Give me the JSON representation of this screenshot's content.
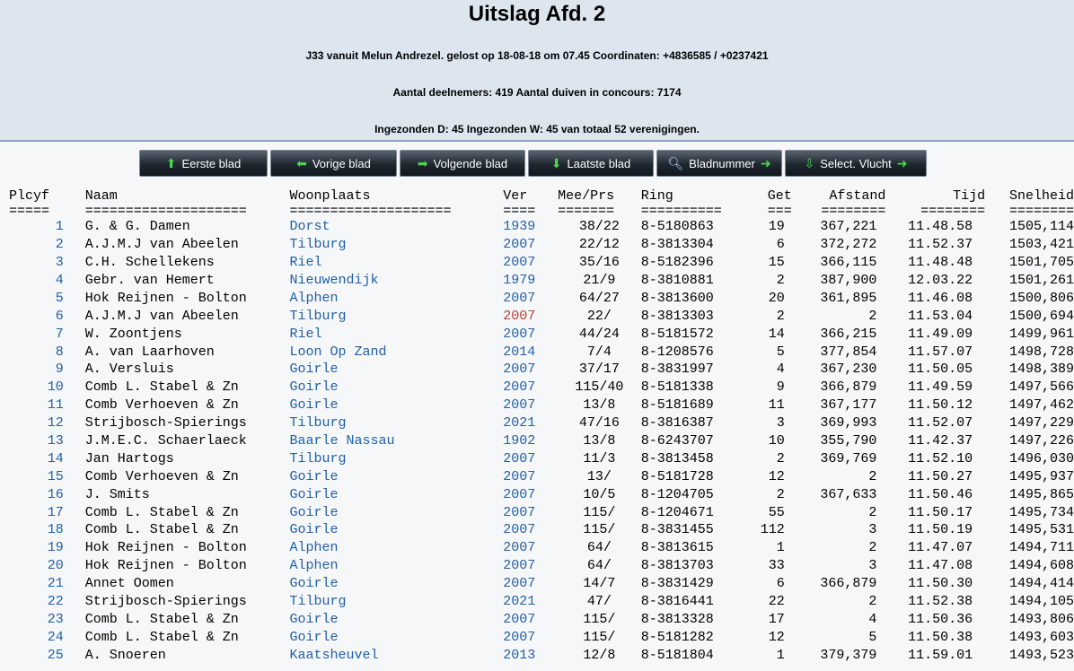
{
  "header": {
    "title": "Uitslag Afd. 2",
    "line1": "J33 vanuit Melun Andrezel. gelost op 18-08-18 om 07.45 Coordinaten: +4836585 / +0237421",
    "line2": "Aantal deelnemers: 419 Aantal duiven in concours: 7174",
    "line3": "Ingezonden D: 45 Ingezonden W: 45 van totaal 52 verenigingen."
  },
  "toolbar": {
    "first": {
      "label": "Eerste blad",
      "icon": "arrow-up-icon"
    },
    "prev": {
      "label": "Vorige blad",
      "icon": "arrow-left-icon"
    },
    "next": {
      "label": "Volgende blad",
      "icon": "arrow-right-icon"
    },
    "last": {
      "label": "Laatste blad",
      "icon": "arrow-down-icon"
    },
    "page": {
      "label": "Bladnummer",
      "icon": "magnifier-icon"
    },
    "select": {
      "label": "Select. Vlucht",
      "icon": "download-icon"
    }
  },
  "table": {
    "headers": [
      "Plcyf",
      "Naam",
      "Woonplaats",
      "Ver",
      "Mee/Prs",
      "Ring",
      "Get",
      "Afstand",
      "Tijd",
      "Snelheid"
    ],
    "separators": [
      "=====",
      "====================",
      "====================",
      "====",
      "=======",
      "==========",
      "===",
      "========",
      "========",
      "========"
    ],
    "rows": [
      [
        "1",
        "G. & G. Damen",
        "Dorst",
        "1939",
        "38/22",
        "8-5180863",
        "19",
        "367,221",
        "11.48.58",
        "1505,114"
      ],
      [
        "2",
        "A.J.M.J van Abeelen",
        "Tilburg",
        "2007",
        "22/12",
        "8-3813304",
        "6",
        "372,272",
        "11.52.37",
        "1503,421"
      ],
      [
        "3",
        "C.H. Schellekens",
        "Riel",
        "2007",
        "35/16",
        "8-5182396",
        "15",
        "366,115",
        "11.48.48",
        "1501,705"
      ],
      [
        "4",
        "Gebr. van Hemert",
        "Nieuwendijk",
        "1979",
        "21/9",
        "8-3810881",
        "2",
        "387,900",
        "12.03.22",
        "1501,261"
      ],
      [
        "5",
        "Hok Reijnen - Bolton",
        "Alphen",
        "2007",
        "64/27",
        "8-3813600",
        "20",
        "361,895",
        "11.46.08",
        "1500,806"
      ],
      [
        "6",
        "A.J.M.J van Abeelen",
        "Tilburg",
        "2007",
        "22/",
        "8-3813303",
        "2",
        "2",
        "11.53.04",
        "1500,694"
      ],
      [
        "7",
        "W. Zoontjens",
        "Riel",
        "2007",
        "44/24",
        "8-5181572",
        "14",
        "366,215",
        "11.49.09",
        "1499,961"
      ],
      [
        "8",
        "A. van Laarhoven",
        "Loon Op Zand",
        "2014",
        "7/4",
        "8-1208576",
        "5",
        "377,854",
        "11.57.07",
        "1498,728"
      ],
      [
        "9",
        "A. Versluis",
        "Goirle",
        "2007",
        "37/17",
        "8-3831997",
        "4",
        "367,230",
        "11.50.05",
        "1498,389"
      ],
      [
        "10",
        "Comb L. Stabel & Zn",
        "Goirle",
        "2007",
        "115/40",
        "8-5181338",
        "9",
        "366,879",
        "11.49.59",
        "1497,566"
      ],
      [
        "11",
        "Comb Verhoeven & Zn",
        "Goirle",
        "2007",
        "13/8",
        "8-5181689",
        "11",
        "367,177",
        "11.50.12",
        "1497,462"
      ],
      [
        "12",
        "Strijbosch-Spierings",
        "Tilburg",
        "2021",
        "47/16",
        "8-3816387",
        "3",
        "369,993",
        "11.52.07",
        "1497,229"
      ],
      [
        "13",
        "J.M.E.C. Schaerlaeck",
        "Baarle Nassau",
        "1902",
        "13/8",
        "8-6243707",
        "10",
        "355,790",
        "11.42.37",
        "1497,226"
      ],
      [
        "14",
        "Jan Hartogs",
        "Tilburg",
        "2007",
        "11/3",
        "8-3813458",
        "2",
        "369,769",
        "11.52.10",
        "1496,030"
      ],
      [
        "15",
        "Comb Verhoeven & Zn",
        "Goirle",
        "2007",
        "13/",
        "8-5181728",
        "12",
        "2",
        "11.50.27",
        "1495,937"
      ],
      [
        "16",
        "J. Smits",
        "Goirle",
        "2007",
        "10/5",
        "8-1204705",
        "2",
        "367,633",
        "11.50.46",
        "1495,865"
      ],
      [
        "17",
        "Comb L. Stabel & Zn",
        "Goirle",
        "2007",
        "115/",
        "8-1204671",
        "55",
        "2",
        "11.50.17",
        "1495,734"
      ],
      [
        "18",
        "Comb L. Stabel & Zn",
        "Goirle",
        "2007",
        "115/",
        "8-3831455",
        "112",
        "3",
        "11.50.19",
        "1495,531"
      ],
      [
        "19",
        "Hok Reijnen - Bolton",
        "Alphen",
        "2007",
        "64/",
        "8-3813615",
        "1",
        "2",
        "11.47.07",
        "1494,711"
      ],
      [
        "20",
        "Hok Reijnen - Bolton",
        "Alphen",
        "2007",
        "64/",
        "8-3813703",
        "33",
        "3",
        "11.47.08",
        "1494,608"
      ],
      [
        "21",
        "Annet Oomen",
        "Goirle",
        "2007",
        "14/7",
        "8-3831429",
        "6",
        "366,879",
        "11.50.30",
        "1494,414"
      ],
      [
        "22",
        "Strijbosch-Spierings",
        "Tilburg",
        "2021",
        "47/",
        "8-3816441",
        "22",
        "2",
        "11.52.38",
        "1494,105"
      ],
      [
        "23",
        "Comb L. Stabel & Zn",
        "Goirle",
        "2007",
        "115/",
        "8-3813328",
        "17",
        "4",
        "11.50.36",
        "1493,806"
      ],
      [
        "24",
        "Comb L. Stabel & Zn",
        "Goirle",
        "2007",
        "115/",
        "8-5181282",
        "12",
        "5",
        "11.50.38",
        "1493,603"
      ],
      [
        "25",
        "A. Snoeren",
        "Kaatsheuvel",
        "2013",
        "12/8",
        "8-5181804",
        "1",
        "379,379",
        "11.59.01",
        "1493,523"
      ]
    ],
    "highlight_ver_row": 5,
    "colors": {
      "link": "#1f5fa8",
      "highlight": "#c0392b"
    }
  }
}
